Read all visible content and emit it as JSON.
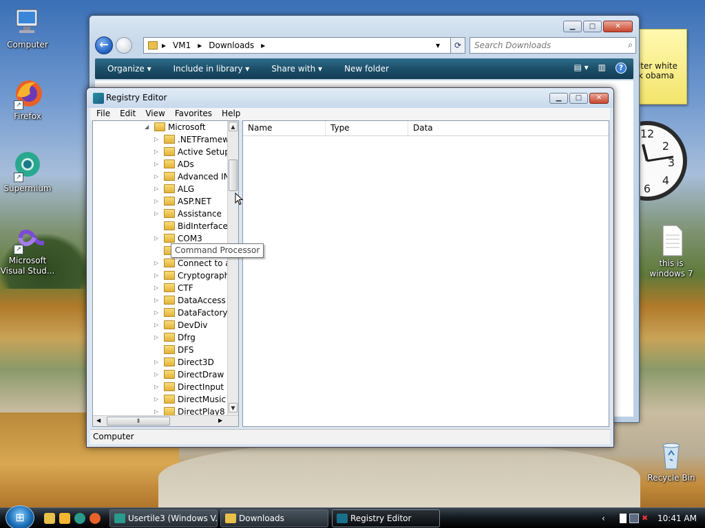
{
  "desktop": {
    "icons": [
      {
        "label": "Computer",
        "icon": "computer-icon"
      },
      {
        "label": "Firefox",
        "icon": "firefox-icon"
      },
      {
        "label": "Supermium",
        "icon": "supermium-icon"
      },
      {
        "label": "Microsoft Visual Stud...",
        "icon": "visual-studio-icon"
      },
      {
        "label": "this is windows 7",
        "icon": "text-file-icon"
      },
      {
        "label": "Recycle Bin",
        "icon": "recycle-bin-icon"
      }
    ],
    "sticky_note": {
      "lines": [
        "lter white",
        "k obama"
      ]
    }
  },
  "explorer": {
    "breadcrumb": [
      "VM1",
      "Downloads"
    ],
    "search_placeholder": "Search Downloads",
    "toolbar": {
      "organize": "Organize",
      "include": "Include in library",
      "share": "Share with",
      "new_folder": "New folder"
    }
  },
  "regedit": {
    "title": "Registry Editor",
    "menu": [
      "File",
      "Edit",
      "View",
      "Favorites",
      "Help"
    ],
    "tree": {
      "root": "Microsoft",
      "items": [
        ".NETFramewo",
        "Active Setup",
        "ADs",
        "Advanced INF",
        "ALG",
        "ASP.NET",
        "Assistance",
        "BidInterface",
        "COM3",
        "Command Processor",
        "Connect to a N",
        "Cryptography",
        "CTF",
        "DataAccess",
        "DataFactory",
        "DevDiv",
        "Dfrg",
        "DFS",
        "Direct3D",
        "DirectDraw",
        "DirectInput",
        "DirectMusic",
        "DirectPlay8"
      ]
    },
    "columns": {
      "name": "Name",
      "type": "Type",
      "data": "Data"
    },
    "status": "Computer",
    "tooltip": "Command Processor"
  },
  "taskbar": {
    "tasks": [
      {
        "label": "Usertile3 (Windows V..."
      },
      {
        "label": "Downloads"
      },
      {
        "label": "Registry Editor"
      }
    ],
    "time": "10:41 AM"
  }
}
